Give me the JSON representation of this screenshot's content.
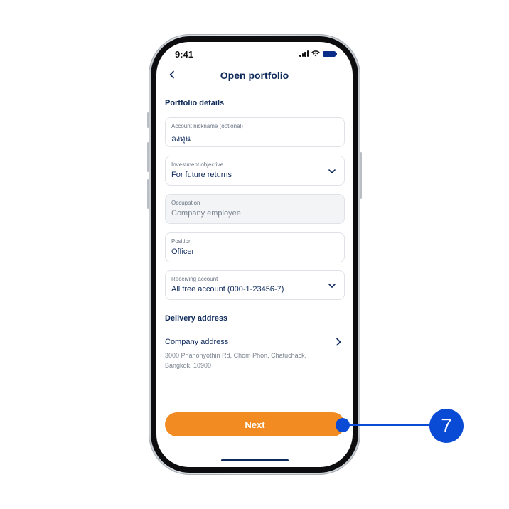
{
  "status_bar": {
    "time": "9:41"
  },
  "header": {
    "title": "Open portfolio"
  },
  "sections": {
    "portfolio_details": "Portfolio details",
    "delivery_address": "Delivery address"
  },
  "fields": [
    {
      "label": "Account nickname (optional)",
      "value": "ลงทุน"
    },
    {
      "label": "Investment objective",
      "value": "For future returns"
    },
    {
      "label": "Occupation",
      "value": "Company employee"
    },
    {
      "label": "Position",
      "value": "Officer"
    },
    {
      "label": "Receiving account",
      "value": "All free account (000-1-23456-7)"
    }
  ],
  "address": {
    "title": "Company address",
    "line1": "3000 Phahonyothin Rd, Chom Phon, Chatuchack,",
    "line2": "Bangkok, 10900"
  },
  "next_button": {
    "label": "Next"
  },
  "callout": {
    "number": "7",
    "color": "#0a4bd6"
  },
  "colors": {
    "primary_text": "#0e2a5b",
    "accent_button": "#f28c22"
  }
}
